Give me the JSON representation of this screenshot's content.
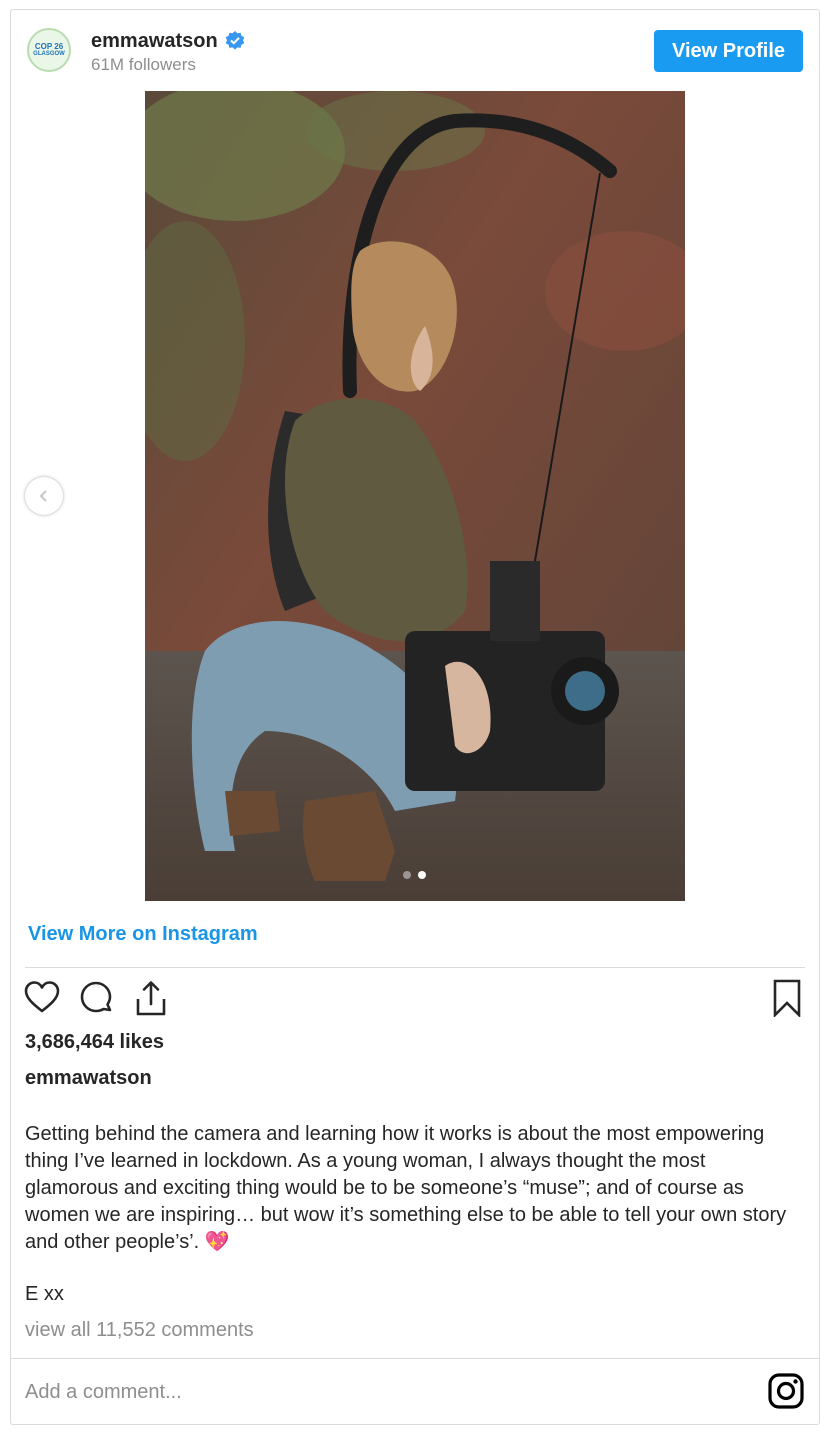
{
  "header": {
    "avatar_line1": "COP 26",
    "avatar_line2": "GLASGOW",
    "username": "emmawatson",
    "followers": "61M followers",
    "view_profile_label": "View Profile"
  },
  "carousel": {
    "slide_index": 2,
    "slide_count": 2
  },
  "view_more_label": "View More on Instagram",
  "likes": "3,686,464 likes",
  "caption": {
    "username": "emmawatson",
    "text": "Getting behind the camera and learning how it works is about the most empowering thing I’ve learned in lockdown. As a young woman, I always thought the most glamorous and exciting thing would be to be someone’s “muse”; and of course as women we are inspiring… but wow it’s something else to be able to tell your own story and other people’s’. 💖",
    "signoff": "E xx"
  },
  "view_comments": "view all 11,552 comments",
  "add_comment_placeholder": "Add a comment...",
  "icons": {
    "like": "heart-icon",
    "comment": "comment-icon",
    "share": "share-icon",
    "save": "bookmark-icon",
    "verified": "verified-badge-icon",
    "prev": "chevron-left-icon",
    "instagram": "instagram-icon"
  },
  "colors": {
    "accent": "#1a9bf2",
    "link": "#1a95e6",
    "muted": "#8e8e8e",
    "text": "#262626"
  }
}
